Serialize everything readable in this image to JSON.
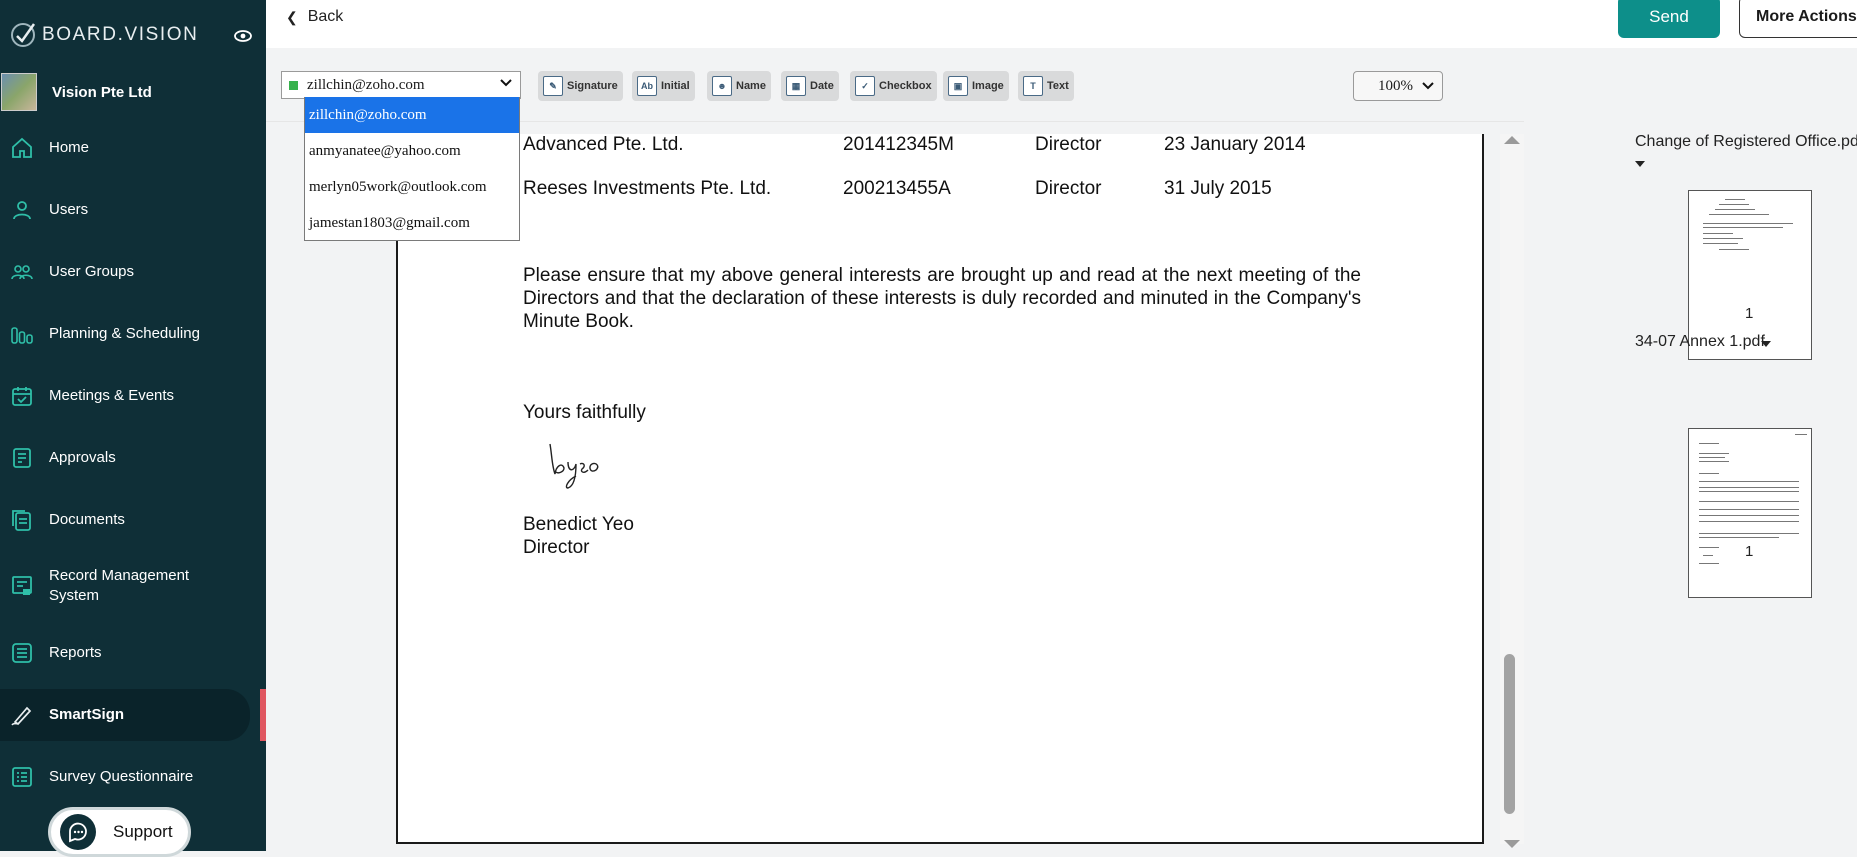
{
  "sidebar": {
    "brand": "BOARD.VISION",
    "org_name": "Vision Pte Ltd",
    "items": [
      {
        "label": "Home",
        "icon": "home-icon"
      },
      {
        "label": "Users",
        "icon": "user-icon"
      },
      {
        "label": "User Groups",
        "icon": "user-group-icon"
      },
      {
        "label": "Planning & Scheduling",
        "icon": "bar-chart-icon"
      },
      {
        "label": "Meetings & Events",
        "icon": "calendar-check-icon"
      },
      {
        "label": "Approvals",
        "icon": "document-check-icon"
      },
      {
        "label": "Documents",
        "icon": "documents-icon"
      },
      {
        "label": "Record Management",
        "label2": "System",
        "icon": "record-management-icon"
      },
      {
        "label": "Reports",
        "icon": "list-icon"
      },
      {
        "label": "SmartSign",
        "icon": "pen-signature-icon"
      },
      {
        "label": "Survey Questionnaire",
        "icon": "checklist-icon"
      }
    ],
    "active_item": "SmartSign",
    "support_label": "Support",
    "accent": "#e05660"
  },
  "topbar": {
    "back_label": "Back",
    "send_label": "Send",
    "more_actions_label": "More Actions"
  },
  "toolbar": {
    "signer_selected": "zillchin@zoho.com",
    "signer_color": "#37b24d",
    "tools": [
      {
        "label": "Signature",
        "icon": "signature-icon"
      },
      {
        "label": "Initial",
        "icon": "initial-icon"
      },
      {
        "label": "Name",
        "icon": "name-icon"
      },
      {
        "label": "Date",
        "icon": "date-icon"
      },
      {
        "label": "Checkbox",
        "icon": "checkbox-icon"
      },
      {
        "label": "Image",
        "icon": "image-icon"
      },
      {
        "label": "Text",
        "icon": "text-icon"
      }
    ],
    "zoom": "100%"
  },
  "signer_dropdown": {
    "options": [
      "zillchin@zoho.com",
      "anmyanatee@yahoo.com",
      "merlyn05work@outlook.com",
      "jamestan1803@gmail.com"
    ],
    "selected_index": 0
  },
  "document": {
    "rows": [
      {
        "company": "Advanced Pte. Ltd.",
        "reg_no": "201412345M",
        "role": "Director",
        "date": "23 January 2014"
      },
      {
        "company": "Reeses Investments Pte. Ltd.",
        "reg_no": "200213455A",
        "role": "Director",
        "date": "31 July 2015"
      }
    ],
    "paragraph": "Please ensure that my above general interests are brought up and read at the next meeting of the Directors and that the declaration of these interests is duly recorded and minuted in the Company's Minute Book.",
    "closing": "Yours faithfully",
    "signer_name": "Benedict Yeo",
    "signer_title": "Director",
    "signature_text": "byeo"
  },
  "files": [
    {
      "name": "Change of Registered Office.pdf",
      "page": "1"
    },
    {
      "name": "34-07 Annex 1.pdf",
      "page": "1"
    }
  ],
  "colors": {
    "sidebar_bg": "#0f2f37",
    "primary": "#0d8f8a",
    "dropdown_highlight": "#1a73e8"
  }
}
